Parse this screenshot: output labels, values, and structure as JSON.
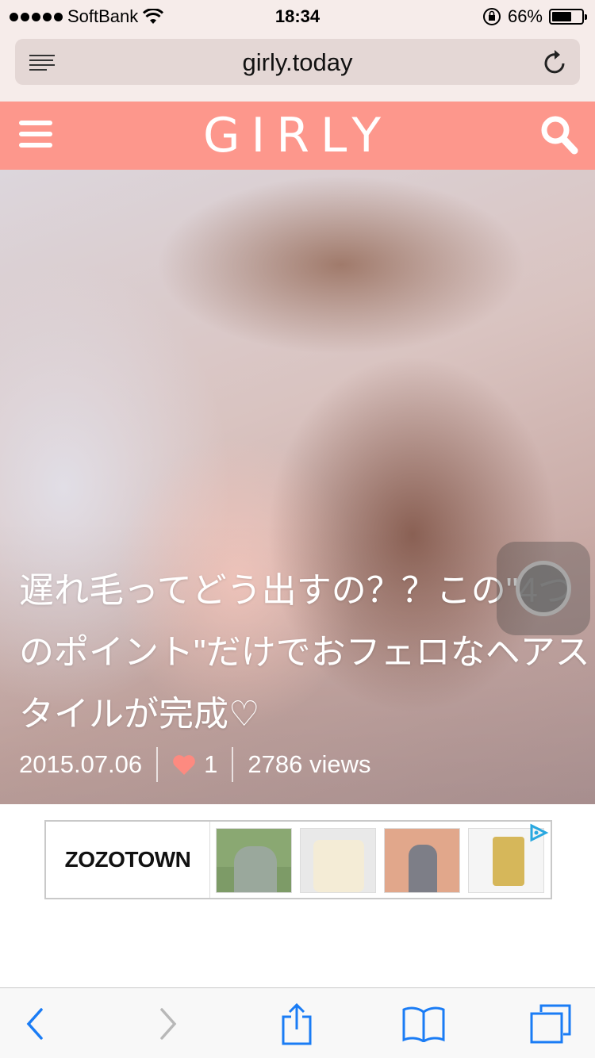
{
  "status_bar": {
    "carrier": "SoftBank",
    "time": "18:34",
    "battery_percent": "66%",
    "battery_level": 0.66
  },
  "browser": {
    "url": "girly.today"
  },
  "site": {
    "logo": "GIRLY"
  },
  "hero": {
    "title": "遅れ毛ってどう出すの？？この\"4つのポイント\"だけでおフェロなヘアスタイルが完成♡",
    "date": "2015.07.06",
    "likes": "1",
    "views": "2786 views"
  },
  "ad": {
    "brand": "ZOZOTOWN",
    "products": [
      "green-knit-outfit",
      "cream-knit-sweater",
      "hat-cardigan-outfit",
      "gold-digital-watch"
    ]
  },
  "colors": {
    "header_bg": "#fd978c",
    "browser_chrome": "#f6ecea",
    "toolbar_tint": "#1a7cf5"
  }
}
